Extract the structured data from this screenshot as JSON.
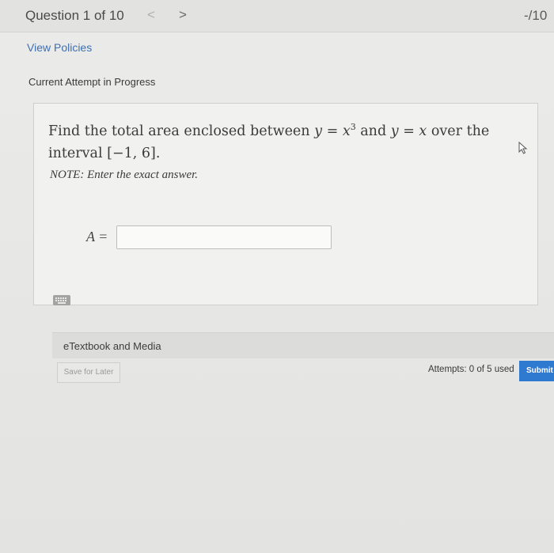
{
  "header": {
    "question_counter": "Question 1 of 10",
    "prev_icon": "<",
    "next_icon": ">",
    "score": "-/10"
  },
  "links": {
    "view_policies": "View Policies"
  },
  "attempt": {
    "heading": "Current Attempt in Progress"
  },
  "question": {
    "text_part1": "Find the total area enclosed between ",
    "eq1_lhs": "y",
    "eq1_op": " = ",
    "eq1_rhs": "x",
    "eq1_exp": "3",
    "text_part2": " and ",
    "eq2_lhs": "y",
    "eq2_op": " = ",
    "eq2_rhs": "x",
    "text_part3": " over the",
    "text_part4": "interval ",
    "interval": "[−1, 6]",
    "text_part5": ".",
    "note": "NOTE: Enter the exact answer.",
    "answer_label": "A =",
    "answer_value": ""
  },
  "resources": {
    "etextbook_label": "eTextbook and Media"
  },
  "footer": {
    "save_later": "Save for Later",
    "attempts": "Attempts: 0 of 5 used",
    "submit": "Submit Answer"
  },
  "colors": {
    "link": "#3e6fb0",
    "submit_bg": "#2f7ad1"
  }
}
